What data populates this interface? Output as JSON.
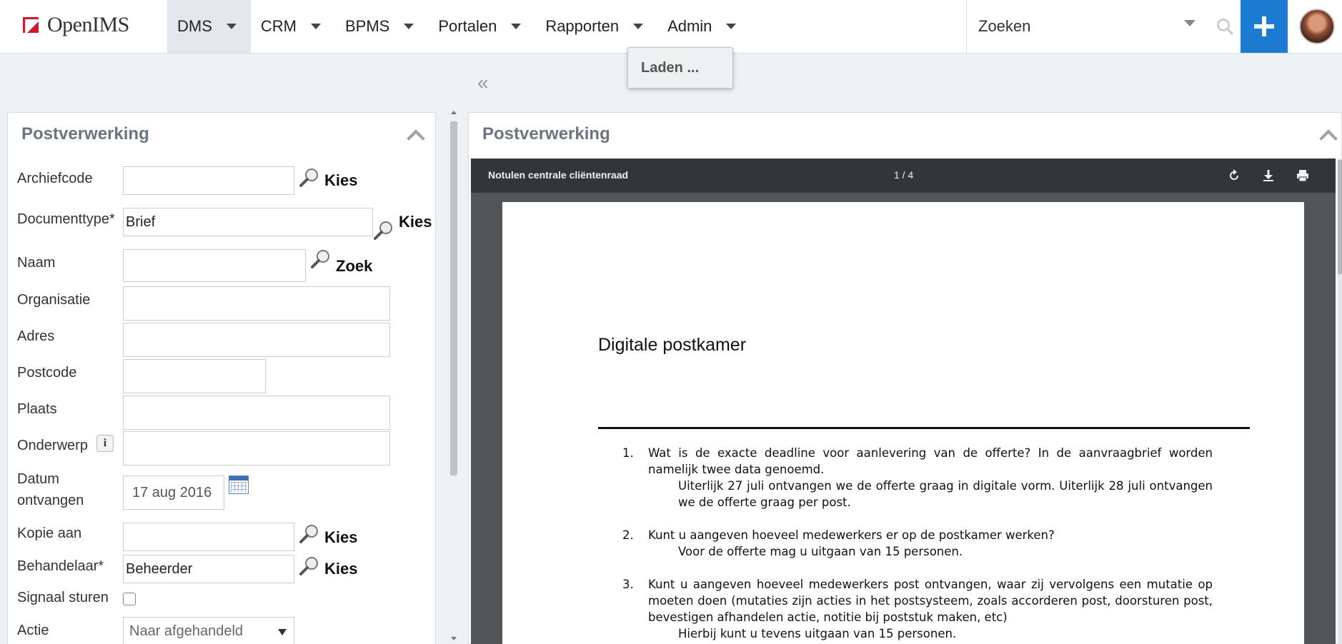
{
  "app": {
    "logo_text": "OpenIMS",
    "brand_color": "#d0182a",
    "accent_color": "#1a7bd1"
  },
  "nav": {
    "items": [
      {
        "label": "DMS",
        "active": true
      },
      {
        "label": "CRM",
        "active": false
      },
      {
        "label": "BPMS",
        "active": false
      },
      {
        "label": "Portalen",
        "active": false
      },
      {
        "label": "Rapporten",
        "active": false
      },
      {
        "label": "Admin",
        "active": false
      }
    ],
    "loading_popup": "Laden ..."
  },
  "search": {
    "placeholder": "Zoeken"
  },
  "left_panel": {
    "title": "Postverwerking",
    "fields": {
      "archiefcode": {
        "label": "Archiefcode",
        "value": "",
        "link": "Kies"
      },
      "documenttype": {
        "label": "Documenttype*",
        "value": "Brief",
        "link": "Kies"
      },
      "naam": {
        "label": "Naam",
        "value": "",
        "link": "Zoek"
      },
      "organisatie": {
        "label": "Organisatie",
        "value": ""
      },
      "adres": {
        "label": "Adres",
        "value": ""
      },
      "postcode": {
        "label": "Postcode",
        "value": ""
      },
      "plaats": {
        "label": "Plaats",
        "value": ""
      },
      "onderwerp": {
        "label": "Onderwerp",
        "value": "",
        "info": "i"
      },
      "datum": {
        "label_line1": "Datum",
        "label_line2": "ontvangen",
        "value": "17 aug 2016"
      },
      "kopie": {
        "label": "Kopie aan",
        "value": "",
        "link": "Kies"
      },
      "behandelaar": {
        "label": "Behandelaar*",
        "value": "Beheerder",
        "link": "Kies"
      },
      "signaal": {
        "label": "Signaal sturen",
        "checked": false
      },
      "actie": {
        "label": "Actie",
        "selected": "Naar afgehandeld"
      }
    }
  },
  "right_panel": {
    "title": "Postverwerking",
    "pdf": {
      "title": "Notulen centrale cliëntenraad",
      "pages": "1 / 4",
      "heading": "Digitale postkamer",
      "items": [
        {
          "num": "1.",
          "question": "Wat is de exacte deadline voor aanlevering van de offerte? In de aanvraagbrief worden namelijk twee data genoemd.",
          "answer": "Uiterlijk 27 juli ontvangen we de offerte graag in digitale vorm. Uiterlijk 28 juli ontvangen we de offerte graag per post."
        },
        {
          "num": "2.",
          "question": "Kunt u aangeven hoeveel medewerkers er op de postkamer werken?",
          "answer": "Voor de offerte mag u uitgaan van 15 personen."
        },
        {
          "num": "3.",
          "question": "Kunt u aangeven hoeveel medewerkers post ontvangen, waar zij vervolgens een mutatie op moeten doen (mutaties zijn acties in het postsysteem, zoals accorderen post, doorsturen post, bevestigen afhandelen actie, notitie bij poststuk maken, etc)",
          "answer": "Hierbij kunt u tevens uitgaan van 15 personen."
        }
      ]
    }
  }
}
